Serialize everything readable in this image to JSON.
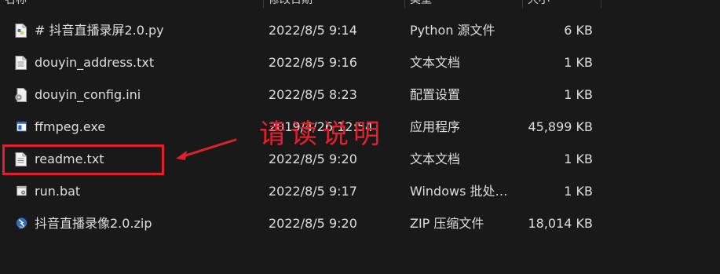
{
  "columns": [
    "名称",
    "修改日期",
    "类型",
    "大小"
  ],
  "files": [
    {
      "name": "# 抖音直播录屏2.0.py",
      "date": "2022/8/5 9:14",
      "type": "Python 源文件",
      "size": "6 KB",
      "icon": "python-file-icon"
    },
    {
      "name": "douyin_address.txt",
      "date": "2022/8/5 9:16",
      "type": "文本文档",
      "size": "1 KB",
      "icon": "text-file-icon"
    },
    {
      "name": "douyin_config.ini",
      "date": "2022/8/5 8:23",
      "type": "配置设置",
      "size": "1 KB",
      "icon": "config-file-icon"
    },
    {
      "name": "ffmpeg.exe",
      "date": "2019/4/26 12:54",
      "type": "应用程序",
      "size": "45,899 KB",
      "icon": "exe-file-icon"
    },
    {
      "name": "readme.txt",
      "date": "2022/8/5 9:20",
      "type": "文本文档",
      "size": "1 KB",
      "icon": "text-file-icon"
    },
    {
      "name": "run.bat",
      "date": "2022/8/5 9:17",
      "type": "Windows 批处…",
      "size": "1 KB",
      "icon": "batch-file-icon"
    },
    {
      "name": "抖音直播录像2.0.zip",
      "date": "2022/8/5 9:20",
      "type": "ZIP 压缩文件",
      "size": "18,014 KB",
      "icon": "zip-file-icon"
    }
  ],
  "annotation": {
    "text": "请读说明",
    "color": "#e0202b"
  }
}
